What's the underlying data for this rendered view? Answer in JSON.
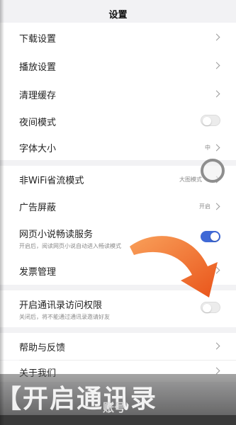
{
  "header": {
    "title": "设置"
  },
  "settings": {
    "download": {
      "label": "下载设置"
    },
    "playback": {
      "label": "播放设置"
    },
    "clear_cache": {
      "label": "清理缓存"
    },
    "night_mode": {
      "label": "夜间模式",
      "enabled": false
    },
    "font_size": {
      "label": "字体大小",
      "value": "中"
    },
    "non_wifi": {
      "label": "非WiFi省流模式",
      "value": "大图模式"
    },
    "ad_block": {
      "label": "广告屏蔽",
      "value": "开启"
    },
    "web_novel": {
      "label": "网页小说畅读服务",
      "desc": "开启后，阅读网页小说自动进入畅读模式",
      "enabled": true
    },
    "invoice": {
      "label": "发票管理"
    },
    "contacts": {
      "label": "开启通讯录访问权限",
      "desc": "关闭后，将不能通过通讯录邀请好友",
      "enabled": false
    },
    "help": {
      "label": "帮助与反馈"
    },
    "about": {
      "label": "关于我们"
    }
  },
  "overlay": {
    "caption": "【开启通讯录",
    "caption_sub": "账号"
  },
  "colors": {
    "toggle_on": "#3f69d6",
    "arrow": "#f06a1e",
    "background": "#f2f2f4"
  }
}
